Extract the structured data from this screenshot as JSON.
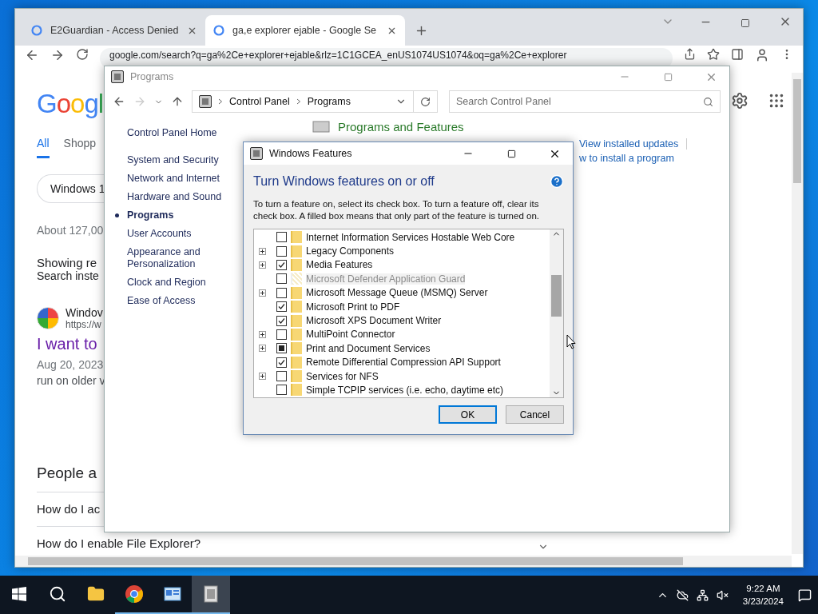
{
  "browser": {
    "tabs": [
      {
        "title": "E2Guardian - Access Denied",
        "selected": false
      },
      {
        "title": "ga,e explorer ejable - Google Se",
        "selected": true
      }
    ],
    "url": "google.com/search?q=ga%2Ce+explorer+ejable&rlz=1C1GCEA_enUS1074US1074&oq=ga%2Ce+explorer"
  },
  "google": {
    "logo": "Googl",
    "search_tabs": [
      {
        "label": "All",
        "selected": true
      },
      {
        "label": "Shopp",
        "selected": false
      }
    ],
    "chip": "Windows 1",
    "result_count": "About 127,00",
    "showing": "Showing re",
    "search_instead": "Search inste",
    "result": {
      "site": "Windov",
      "url": "https://w",
      "title": "I want to",
      "date": "Aug 20, 2023",
      "snippet": "run on older v"
    },
    "people_heading": "People a",
    "questions": [
      "How do I ac",
      "How do I enable File Explorer?"
    ]
  },
  "control_panel": {
    "title": "Programs",
    "breadcrumbs": [
      "Control Panel",
      "Programs"
    ],
    "search": {
      "placeholder": "Search Control Panel"
    },
    "sidebar": [
      {
        "label": "Control Panel Home",
        "selected": false
      },
      {
        "label": "System and Security",
        "selected": false
      },
      {
        "label": "Network and Internet",
        "selected": false
      },
      {
        "label": "Hardware and Sound",
        "selected": false
      },
      {
        "label": "Programs",
        "selected": true
      },
      {
        "label": "User Accounts",
        "selected": false
      },
      {
        "label": "Appearance and Personalization",
        "selected": false
      },
      {
        "label": "Clock and Region",
        "selected": false
      },
      {
        "label": "Ease of Access",
        "selected": false
      }
    ],
    "heading": "Programs and Features",
    "links": [
      "View installed updates",
      "w to install a program"
    ]
  },
  "dialog": {
    "title": "Windows Features",
    "heading": "Turn Windows features on or off",
    "description": "To turn a feature on, select its check box. To turn a feature off, clear its check box. A filled box means that only part of the feature is turned on.",
    "features": [
      {
        "label": "Internet Information Services Hostable Web Core",
        "expandable": false,
        "checked": false,
        "partial": false,
        "disabled": false
      },
      {
        "label": "Legacy Components",
        "expandable": true,
        "checked": false,
        "partial": false,
        "disabled": false
      },
      {
        "label": "Media Features",
        "expandable": true,
        "checked": true,
        "partial": false,
        "disabled": false
      },
      {
        "label": "Microsoft Defender Application Guard",
        "expandable": false,
        "checked": false,
        "partial": false,
        "disabled": true
      },
      {
        "label": "Microsoft Message Queue (MSMQ) Server",
        "expandable": true,
        "checked": false,
        "partial": false,
        "disabled": false
      },
      {
        "label": "Microsoft Print to PDF",
        "expandable": false,
        "checked": true,
        "partial": false,
        "disabled": false
      },
      {
        "label": "Microsoft XPS Document Writer",
        "expandable": false,
        "checked": true,
        "partial": false,
        "disabled": false
      },
      {
        "label": "MultiPoint Connector",
        "expandable": true,
        "checked": false,
        "partial": false,
        "disabled": false
      },
      {
        "label": "Print and Document Services",
        "expandable": true,
        "checked": false,
        "partial": true,
        "disabled": false
      },
      {
        "label": "Remote Differential Compression API Support",
        "expandable": false,
        "checked": true,
        "partial": false,
        "disabled": false
      },
      {
        "label": "Services for NFS",
        "expandable": true,
        "checked": false,
        "partial": false,
        "disabled": false
      },
      {
        "label": "Simple TCPIP services (i.e. echo, daytime etc)",
        "expandable": false,
        "checked": false,
        "partial": false,
        "disabled": false
      }
    ],
    "buttons": [
      {
        "label": "OK",
        "kind": "default"
      },
      {
        "label": "Cancel",
        "kind": "normal"
      }
    ]
  },
  "taskbar": {
    "apps": [
      {
        "kind": "explorer",
        "running": false,
        "active": false
      },
      {
        "kind": "chrome",
        "running": true,
        "active": false
      },
      {
        "kind": "control",
        "running": true,
        "active": false
      },
      {
        "kind": "features",
        "running": true,
        "active": true
      }
    ],
    "time": "9:22 AM",
    "date": "3/23/2024"
  }
}
